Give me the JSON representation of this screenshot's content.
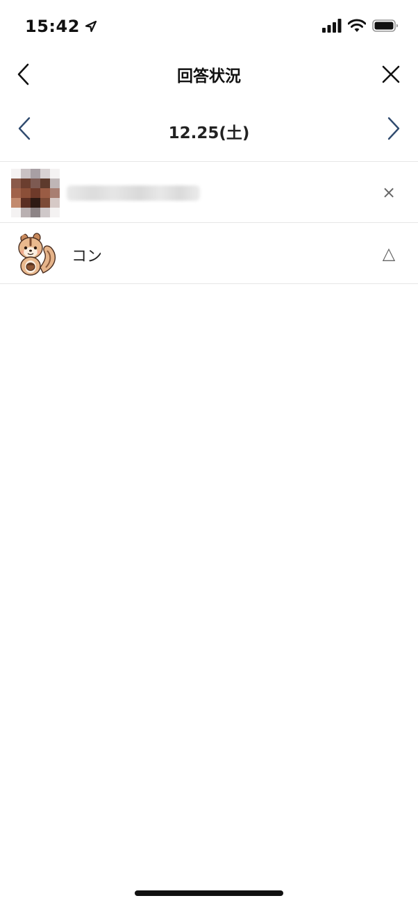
{
  "status_bar": {
    "time": "15:42",
    "icons": [
      "location-arrow-icon",
      "cellular-signal-icon",
      "wifi-icon",
      "battery-icon"
    ]
  },
  "header": {
    "title": "回答状況",
    "back_icon": "chevron-left-icon",
    "close_icon": "close-icon"
  },
  "date_nav": {
    "date": "12.25(土)",
    "prev_icon": "chevron-left-icon",
    "next_icon": "chevron-right-icon",
    "chevron_color": "#2f4a6e"
  },
  "responses": [
    {
      "name": "",
      "avatar": "pixelated-avatar",
      "status": "×"
    },
    {
      "name": "コン",
      "avatar": "chipmunk-avatar",
      "status": "△"
    }
  ]
}
